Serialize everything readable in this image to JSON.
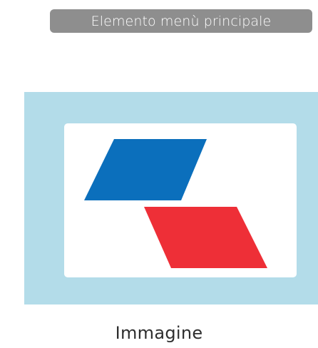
{
  "menu_item": {
    "label": "Elemento menù principale"
  },
  "image": {
    "caption": "Immagine",
    "placeholder_icon": "image-placeholder-icon",
    "frame_color": "#b3dce9",
    "card_color": "#ffffff",
    "shape_colors": {
      "top": "#0b6fbc",
      "bottom": "#ee2f37"
    }
  }
}
